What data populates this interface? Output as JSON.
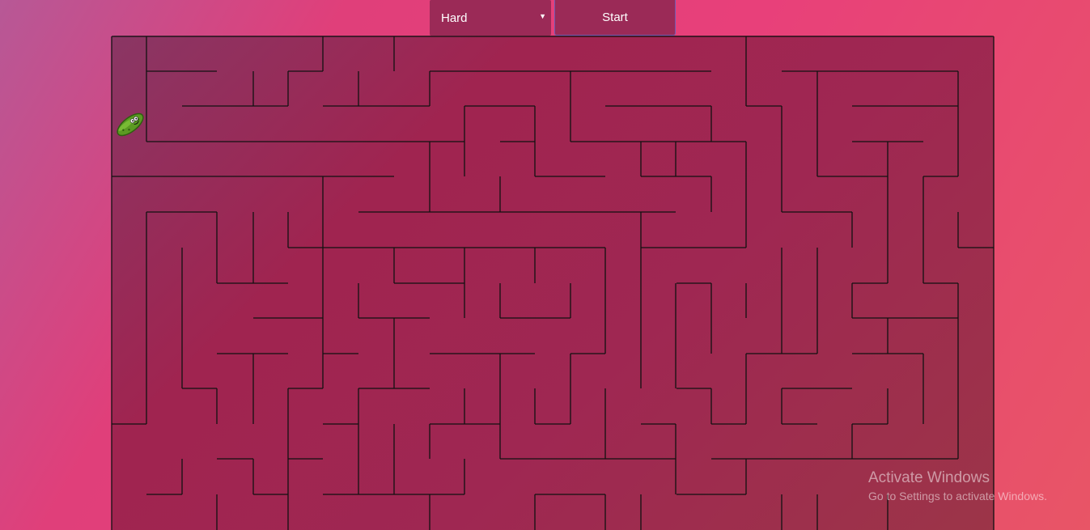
{
  "controls": {
    "difficulty": "Hard",
    "start_label": "Start"
  },
  "maze": {
    "wall_color": "#111111",
    "background_start": "#8a3664",
    "background_end": "#9c3548",
    "player_icon": "pickle-icon"
  },
  "watermark": {
    "title": "Activate Windows",
    "subtitle": "Go to Settings to activate Windows."
  }
}
